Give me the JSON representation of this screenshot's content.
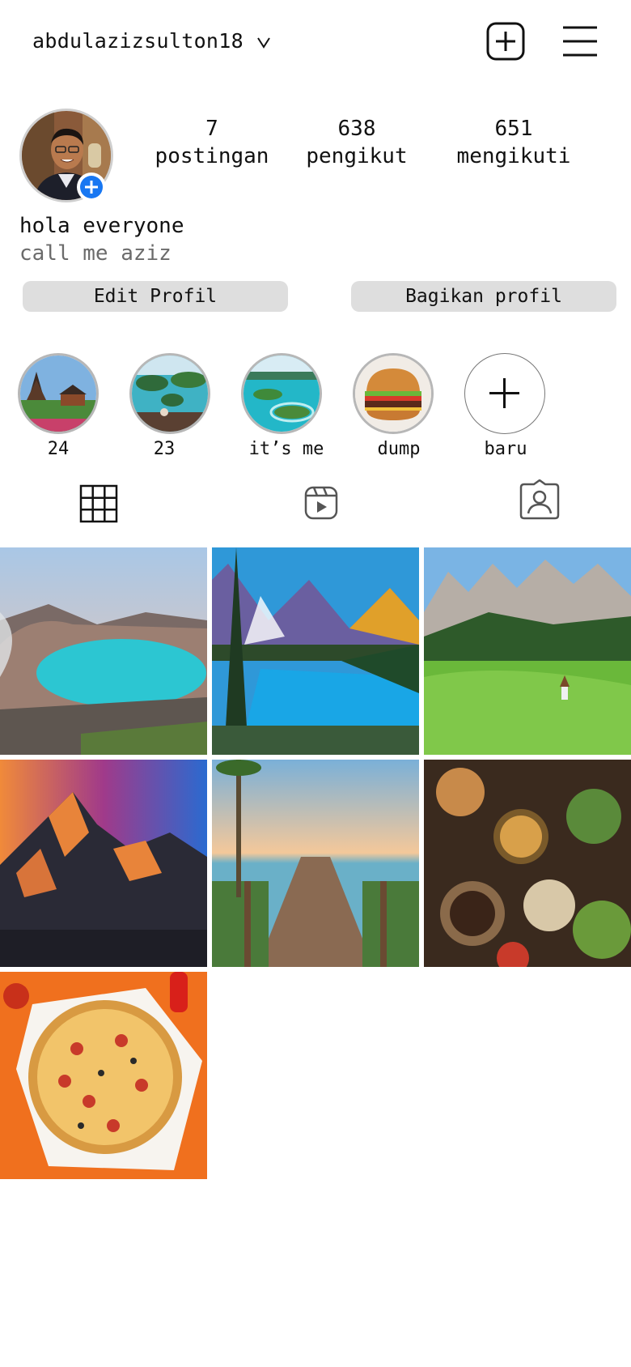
{
  "header": {
    "username": "abdulazizsulton18",
    "chevron_icon": "chevron-down-icon",
    "add_icon": "plus-square-icon",
    "menu_icon": "hamburger-menu-icon"
  },
  "profile": {
    "avatar_icon": "profile-photo",
    "add_story_icon": "plus-circle-icon",
    "stats": [
      {
        "value": "7",
        "label": "postingan"
      },
      {
        "value": "638",
        "label": "pengikut"
      },
      {
        "value": "651",
        "label": "mengikuti"
      }
    ],
    "bio_name": "hola everyone",
    "bio_text": "call me aziz",
    "edit_button": "Edit Profil",
    "share_button": "Bagikan profil"
  },
  "highlights": [
    {
      "label": "24",
      "image": "temple-landscape"
    },
    {
      "label": "23",
      "image": "tropical-islands"
    },
    {
      "label": "it’s me",
      "image": "lagoon-islands"
    },
    {
      "label": "dump",
      "image": "burger"
    },
    {
      "label": "baru",
      "image": "plus-icon"
    }
  ],
  "tabs": [
    {
      "name": "posts-grid",
      "icon": "grid-icon"
    },
    {
      "name": "reels",
      "icon": "reels-icon"
    },
    {
      "name": "tagged",
      "icon": "tagged-person-icon"
    }
  ],
  "posts": [
    {
      "image": "crater-lake"
    },
    {
      "image": "mountain-lake"
    },
    {
      "image": "alpine-meadow"
    },
    {
      "image": "sunset-peaks"
    },
    {
      "image": "beach-pier"
    },
    {
      "image": "food-spread"
    },
    {
      "image": "pizza"
    }
  ],
  "colors": {
    "accent_blue": "#1877f2",
    "button_bg": "#dedede",
    "secondary_text": "#6b6b6b"
  }
}
